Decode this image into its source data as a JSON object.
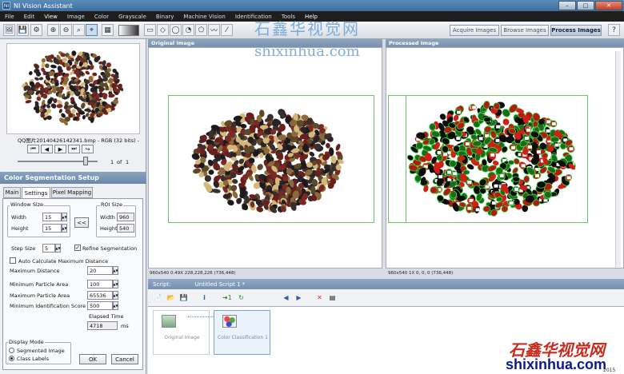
{
  "window": {
    "title": "NI Vision Assistant",
    "app_icon": "NI",
    "minimize": "–",
    "maximize": "□",
    "close": "✕"
  },
  "menu": [
    "File",
    "Edit",
    "View",
    "Image",
    "Color",
    "Grayscale",
    "Binary",
    "Machine Vision",
    "Identification",
    "Tools",
    "Help"
  ],
  "toolbar": {
    "mode_tabs": [
      {
        "label": "Acquire Images",
        "active": false
      },
      {
        "label": "Browse Images",
        "active": false
      },
      {
        "label": "Process Images",
        "active": true
      }
    ]
  },
  "browser": {
    "filename": "QQ图片20140426142341.bmp - RGB (32 bits) -",
    "page_current": "1",
    "page_of": "of",
    "page_total": "1"
  },
  "setup": {
    "title": "Color Segmentation Setup",
    "tabs": [
      {
        "label": "Main",
        "active": false
      },
      {
        "label": "Settings",
        "active": true
      },
      {
        "label": "Pixel Mapping",
        "active": false
      }
    ],
    "window_size": {
      "label": "Window Size",
      "width_label": "Width",
      "width": "15",
      "height_label": "Height",
      "height": "15"
    },
    "arrow_button": "<<",
    "roi_size": {
      "label": "ROI Size",
      "width_label": "Width",
      "width": "960",
      "height_label": "Height",
      "height": "540"
    },
    "step_size": {
      "label": "Step Size",
      "value": "5"
    },
    "refine": {
      "label": "Refine Segmentation",
      "checked": true
    },
    "auto_calc": {
      "label": "Auto Calculate Maximum Distance",
      "checked": false
    },
    "max_distance": {
      "label": "Maximum Distance",
      "value": "20"
    },
    "min_particle": {
      "label": "Minimum Particle Area",
      "value": "100"
    },
    "max_particle": {
      "label": "Maximum Particle Area",
      "value": "65536"
    },
    "min_score": {
      "label": "Minimum Identification Score",
      "value": "500"
    },
    "elapsed": {
      "label": "Elapsed Time",
      "value": "4718",
      "unit": "ms"
    },
    "display_mode": {
      "label": "Display Mode",
      "options": [
        {
          "label": "Segmented Image",
          "selected": false
        },
        {
          "label": "Class Labels",
          "selected": true
        }
      ]
    },
    "ok": "OK",
    "cancel": "Cancel"
  },
  "original": {
    "header": "Original Image",
    "status": "960x540 0.49X 228,228,226   (736,448)"
  },
  "processed": {
    "header": "Processed Image",
    "status": "960x540 1X 0, 0, 0   (736,448)"
  },
  "script": {
    "label": "Script:",
    "name": "Untitled Script 1 *",
    "steps": [
      {
        "label": "Original Image",
        "selected": false
      },
      {
        "label": "Color Classification 1",
        "selected": true
      }
    ]
  },
  "watermark": {
    "line1": "石鑫华视觉网",
    "line2": "shixinhua.com",
    "bottom_cn": "石鑫华视觉网",
    "bottom_url": "shixinhua.com",
    "corner": "2015"
  },
  "colors": {
    "titlebar": "#4b7aa8",
    "panel_header": "#7c94b3",
    "accent_select": "#c9dcf0",
    "watermark": "#6aa0d8",
    "bottom_cn": "#c62d1f",
    "bottom_url": "#0d1b8a"
  }
}
